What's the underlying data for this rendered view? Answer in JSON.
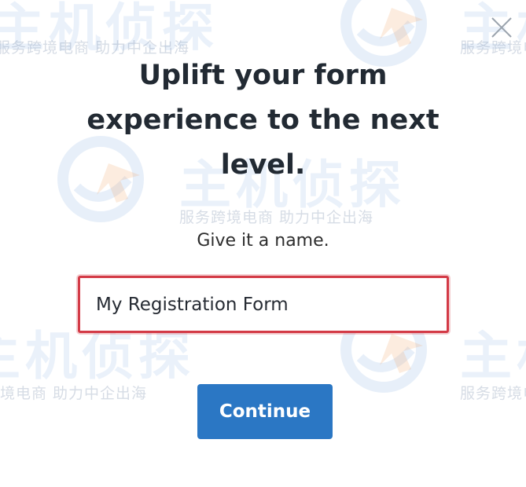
{
  "modal": {
    "headline": "Uplift your form experience to the next level.",
    "subtitle": "Give it a name.",
    "name_input": {
      "value": "My Registration Form",
      "placeholder": ""
    },
    "continue_label": "Continue",
    "close_icon": "close-icon"
  },
  "watermark": {
    "brand": "主机侦探",
    "slogan": "服务跨境电商 助力中企出海"
  },
  "colors": {
    "headline_text": "#222a33",
    "button_bg": "#2b77c4",
    "input_border_error": "#d33a46",
    "watermark": "#5f96d7"
  }
}
